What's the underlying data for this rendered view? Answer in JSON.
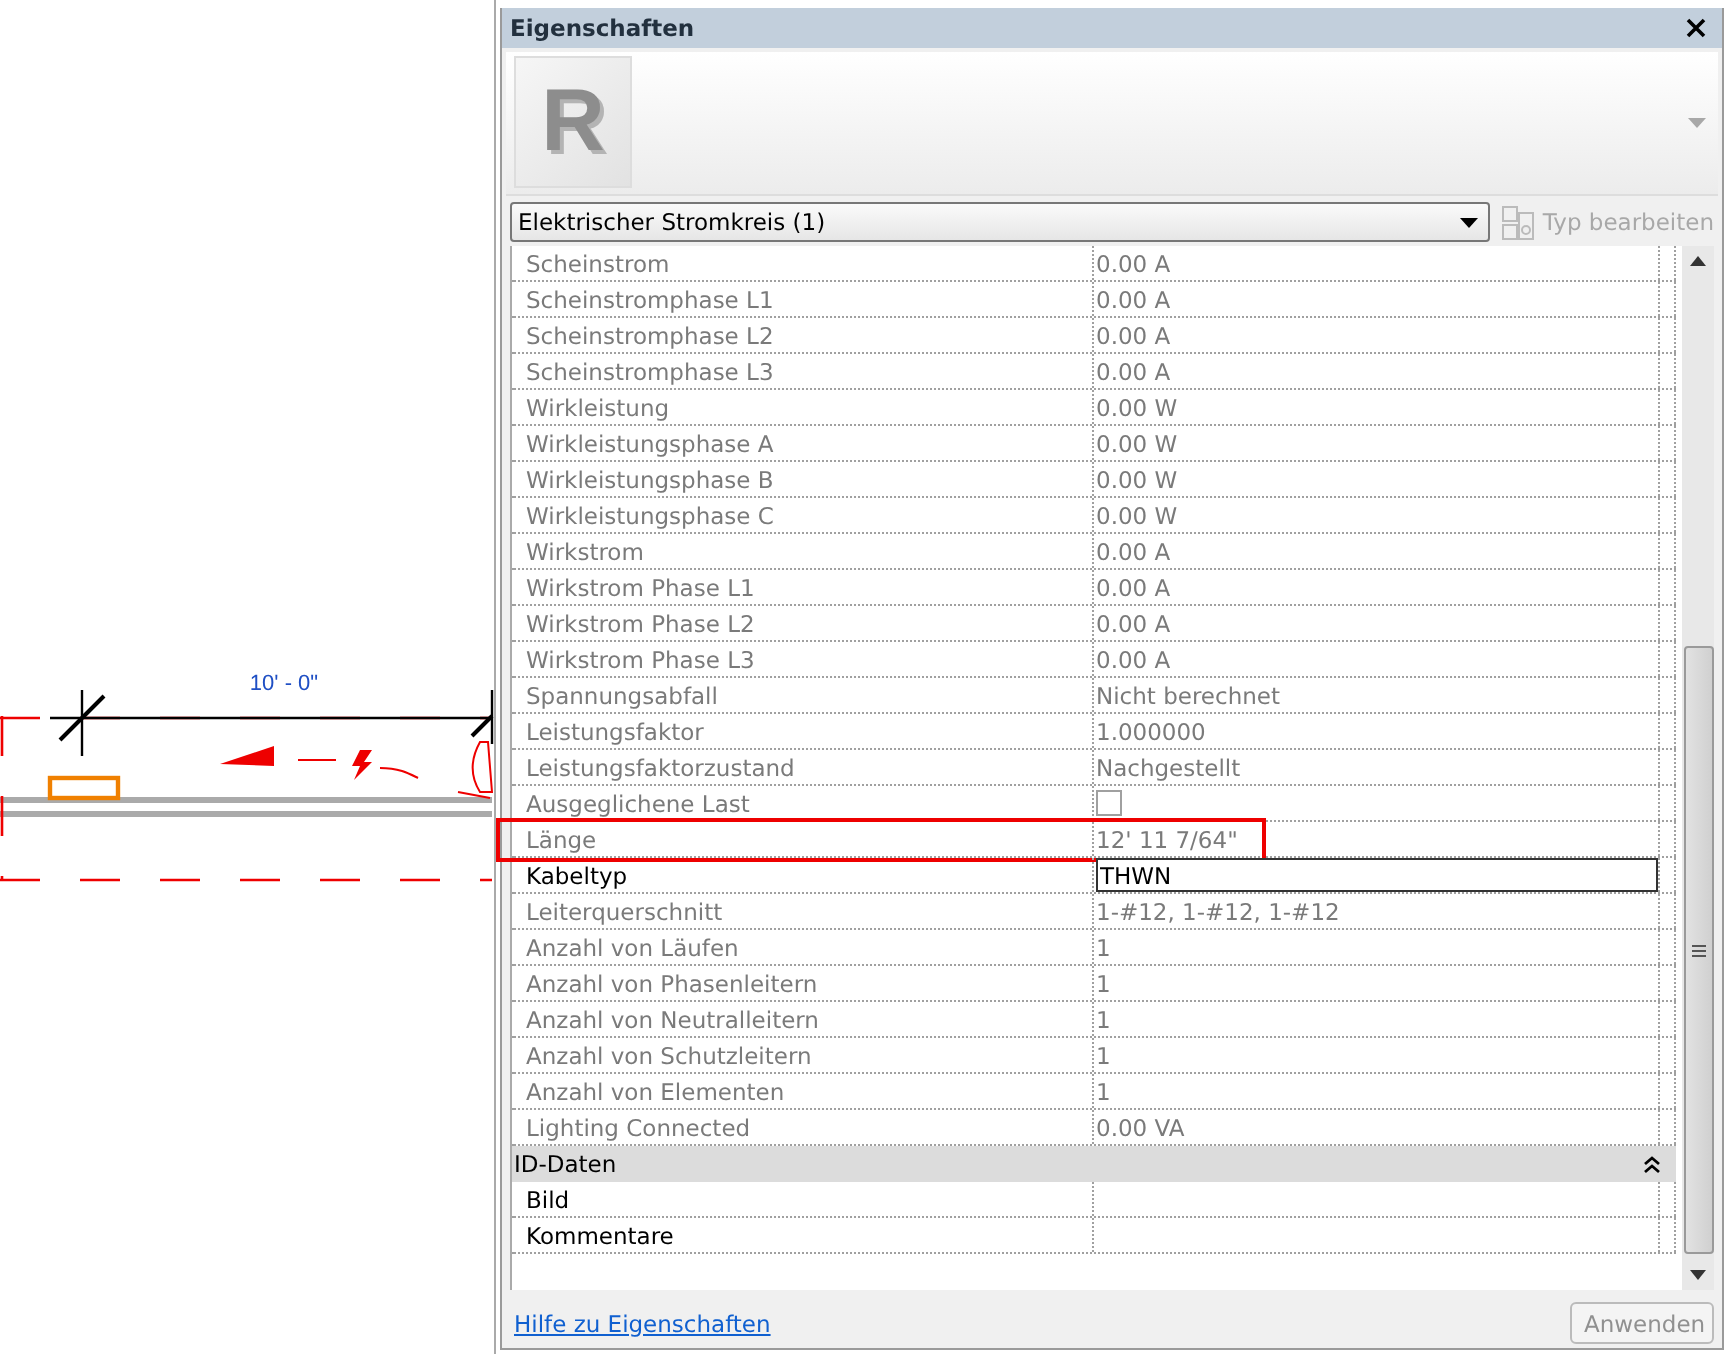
{
  "canvas": {
    "dimension_label": "10' - 0\""
  },
  "properties_panel": {
    "title": "Eigenschaften",
    "preview_letter": "R",
    "type_selector": {
      "value": "Elektrischer Stromkreis (1)"
    },
    "edit_type_button": {
      "label": "Typ bearbeiten",
      "disabled": true
    },
    "rows": [
      {
        "label": "Scheinstrom",
        "kind": "text",
        "value": "0.00 A",
        "read_only": true,
        "highlighted": false
      },
      {
        "label": "Scheinstromphase L1",
        "kind": "text",
        "value": "0.00 A",
        "read_only": true,
        "highlighted": false
      },
      {
        "label": "Scheinstromphase L2",
        "kind": "text",
        "value": "0.00 A",
        "read_only": true,
        "highlighted": false
      },
      {
        "label": "Scheinstromphase L3",
        "kind": "text",
        "value": "0.00 A",
        "read_only": true,
        "highlighted": false
      },
      {
        "label": "Wirkleistung",
        "kind": "text",
        "value": "0.00 W",
        "read_only": true,
        "highlighted": false
      },
      {
        "label": "Wirkleistungsphase A",
        "kind": "text",
        "value": "0.00 W",
        "read_only": true,
        "highlighted": false
      },
      {
        "label": "Wirkleistungsphase B",
        "kind": "text",
        "value": "0.00 W",
        "read_only": true,
        "highlighted": false
      },
      {
        "label": "Wirkleistungsphase C",
        "kind": "text",
        "value": "0.00 W",
        "read_only": true,
        "highlighted": false
      },
      {
        "label": "Wirkstrom",
        "kind": "text",
        "value": "0.00 A",
        "read_only": true,
        "highlighted": false
      },
      {
        "label": "Wirkstrom Phase L1",
        "kind": "text",
        "value": "0.00 A",
        "read_only": true,
        "highlighted": false
      },
      {
        "label": "Wirkstrom Phase L2",
        "kind": "text",
        "value": "0.00 A",
        "read_only": true,
        "highlighted": false
      },
      {
        "label": "Wirkstrom Phase L3",
        "kind": "text",
        "value": "0.00 A",
        "read_only": true,
        "highlighted": false
      },
      {
        "label": "Spannungsabfall",
        "kind": "text",
        "value": "Nicht berechnet",
        "read_only": true,
        "highlighted": false
      },
      {
        "label": "Leistungsfaktor",
        "kind": "text",
        "value": "1.000000",
        "read_only": true,
        "highlighted": false
      },
      {
        "label": "Leistungsfaktorzustand",
        "kind": "text",
        "value": "Nachgestellt",
        "read_only": true,
        "highlighted": false
      },
      {
        "label": "Ausgeglichene Last",
        "kind": "checkbox",
        "checked": false,
        "read_only": true,
        "highlighted": false
      },
      {
        "label": "Länge",
        "kind": "text",
        "value": "12'  11 7/64\"",
        "read_only": true,
        "highlighted": true
      },
      {
        "label": "Kabeltyp",
        "kind": "field",
        "value": "THWN",
        "read_only": false,
        "highlighted": false
      },
      {
        "label": "Leiterquerschnitt",
        "kind": "text",
        "value": "1-#12, 1-#12, 1-#12",
        "read_only": true,
        "highlighted": false
      },
      {
        "label": "Anzahl von Läufen",
        "kind": "text",
        "value": "1",
        "read_only": true,
        "highlighted": false
      },
      {
        "label": "Anzahl von Phasenleitern",
        "kind": "text",
        "value": "1",
        "read_only": true,
        "highlighted": false
      },
      {
        "label": "Anzahl von Neutralleitern",
        "kind": "text",
        "value": "1",
        "read_only": true,
        "highlighted": false
      },
      {
        "label": "Anzahl von Schutzleitern",
        "kind": "text",
        "value": "1",
        "read_only": true,
        "highlighted": false
      },
      {
        "label": "Anzahl von Elementen",
        "kind": "text",
        "value": "1",
        "read_only": true,
        "highlighted": false
      },
      {
        "label": "Lighting Connected",
        "kind": "text",
        "value": "0.00 VA",
        "read_only": true,
        "highlighted": false
      }
    ],
    "sections": [
      {
        "title": "ID-Daten",
        "expanded": true,
        "rows": [
          {
            "label": "Bild",
            "read_only": false,
            "highlighted": false
          },
          {
            "label": "Kommentare",
            "read_only": false,
            "highlighted": false
          }
        ]
      }
    ],
    "help_link": "Hilfe zu Eigenschaften",
    "apply_button": {
      "label": "Anwenden",
      "disabled": true
    }
  }
}
